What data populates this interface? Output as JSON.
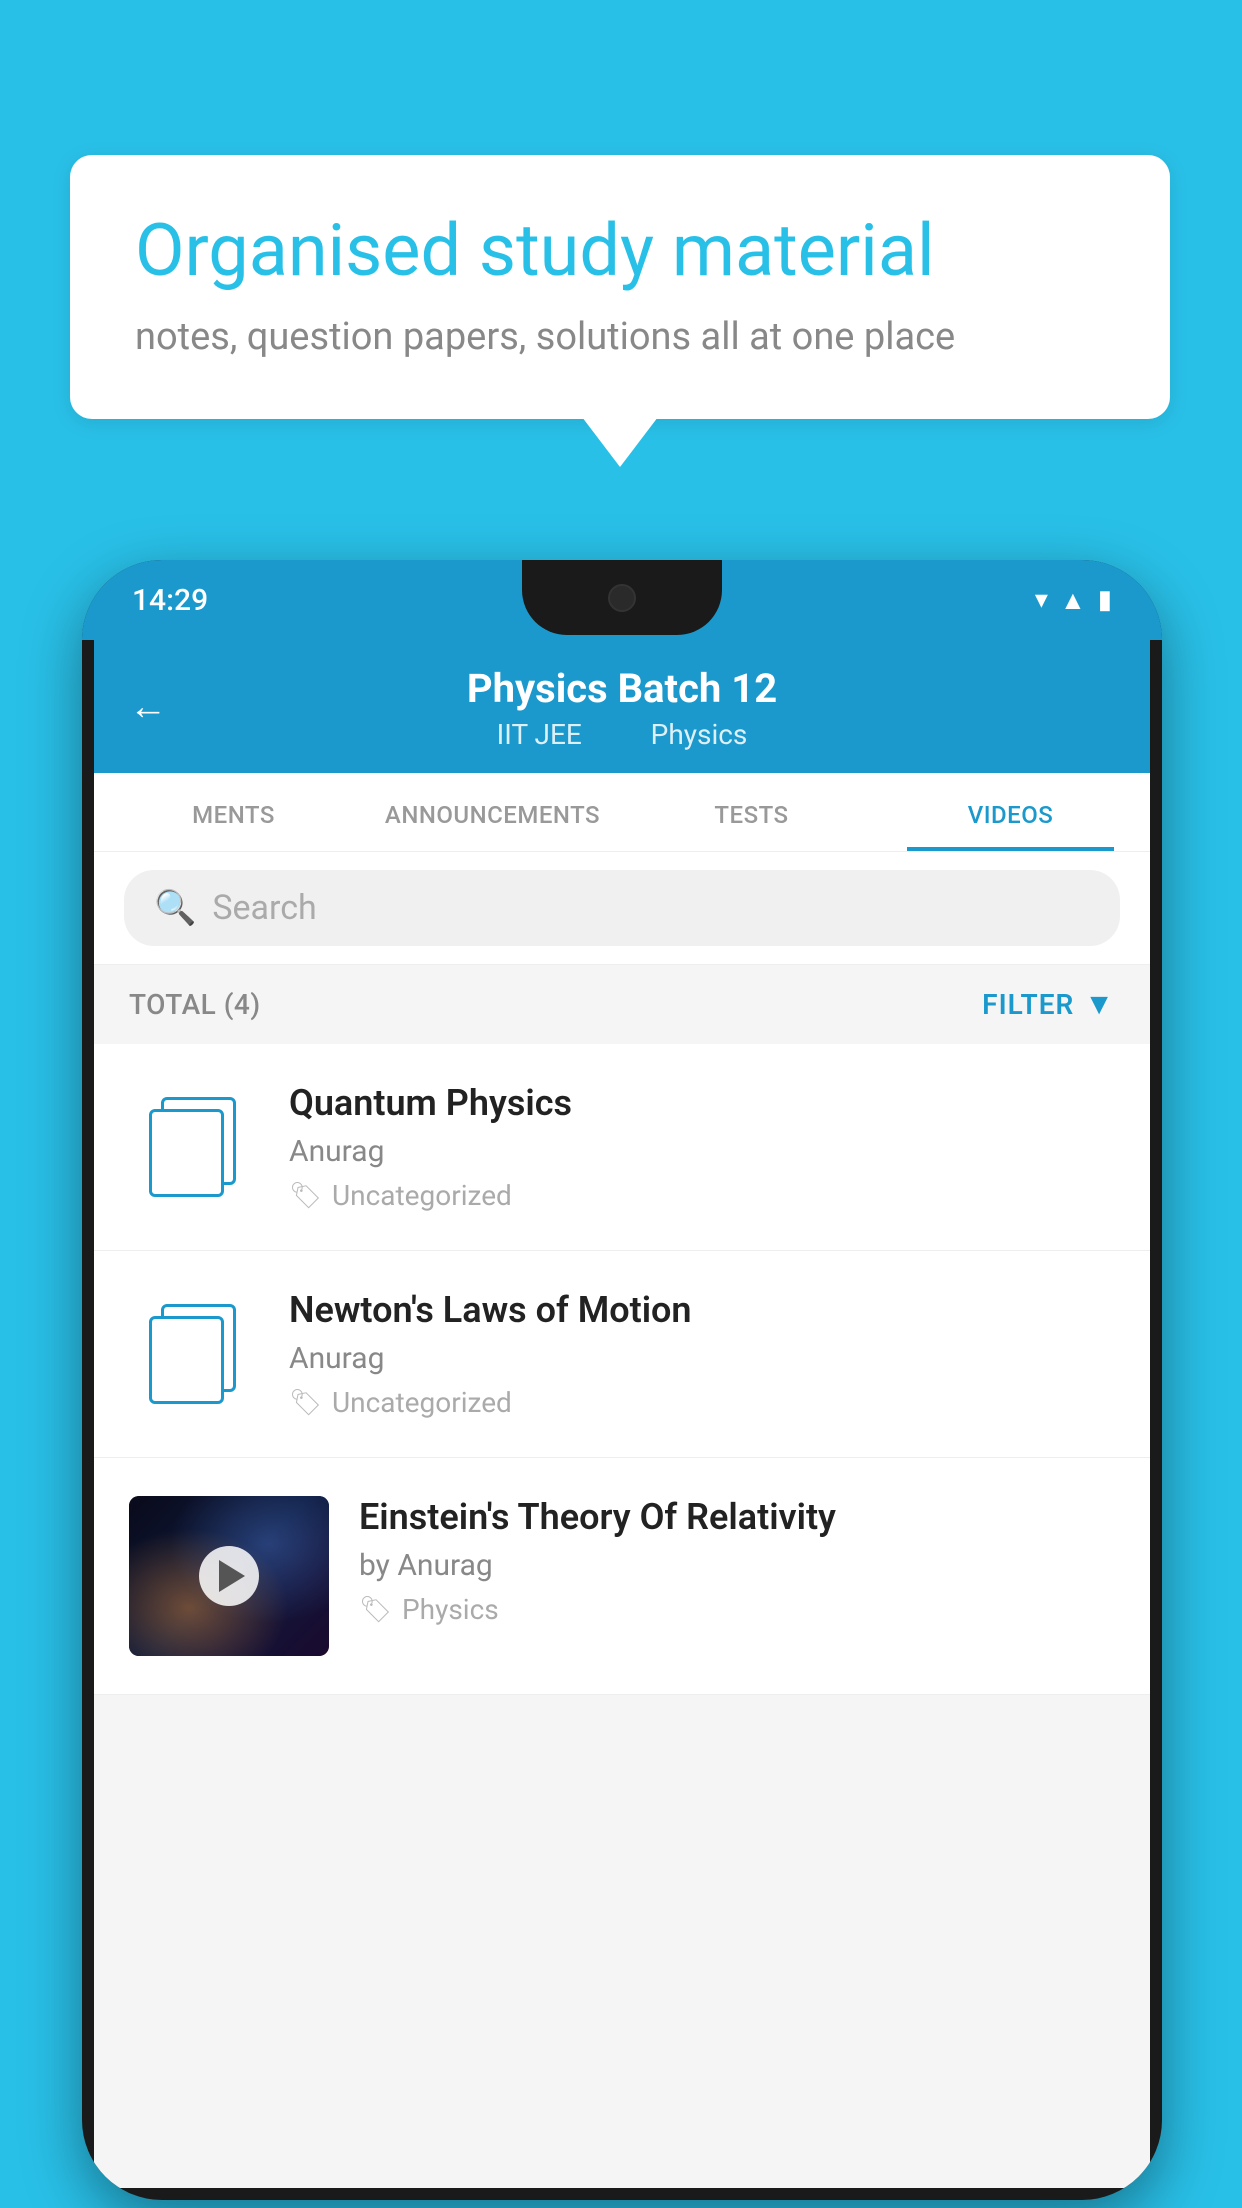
{
  "background": {
    "color": "#29C0E8"
  },
  "speech_bubble": {
    "title": "Organised study material",
    "subtitle": "notes, question papers, solutions all at one place"
  },
  "phone": {
    "status_bar": {
      "time": "14:29"
    },
    "app_header": {
      "title": "Physics Batch 12",
      "tag1": "IIT JEE",
      "tag2": "Physics",
      "back_label": "←"
    },
    "tabs": [
      {
        "label": "MENTS",
        "active": false
      },
      {
        "label": "ANNOUNCEMENTS",
        "active": false
      },
      {
        "label": "TESTS",
        "active": false
      },
      {
        "label": "VIDEOS",
        "active": true
      }
    ],
    "search": {
      "placeholder": "Search"
    },
    "filter_bar": {
      "total_label": "TOTAL (4)",
      "filter_label": "FILTER"
    },
    "videos": [
      {
        "title": "Quantum Physics",
        "author": "Anurag",
        "tag": "Uncategorized",
        "has_thumbnail": false
      },
      {
        "title": "Newton's Laws of Motion",
        "author": "Anurag",
        "tag": "Uncategorized",
        "has_thumbnail": false
      },
      {
        "title": "Einstein's Theory Of Relativity",
        "author": "by Anurag",
        "tag": "Physics",
        "has_thumbnail": true
      }
    ]
  }
}
